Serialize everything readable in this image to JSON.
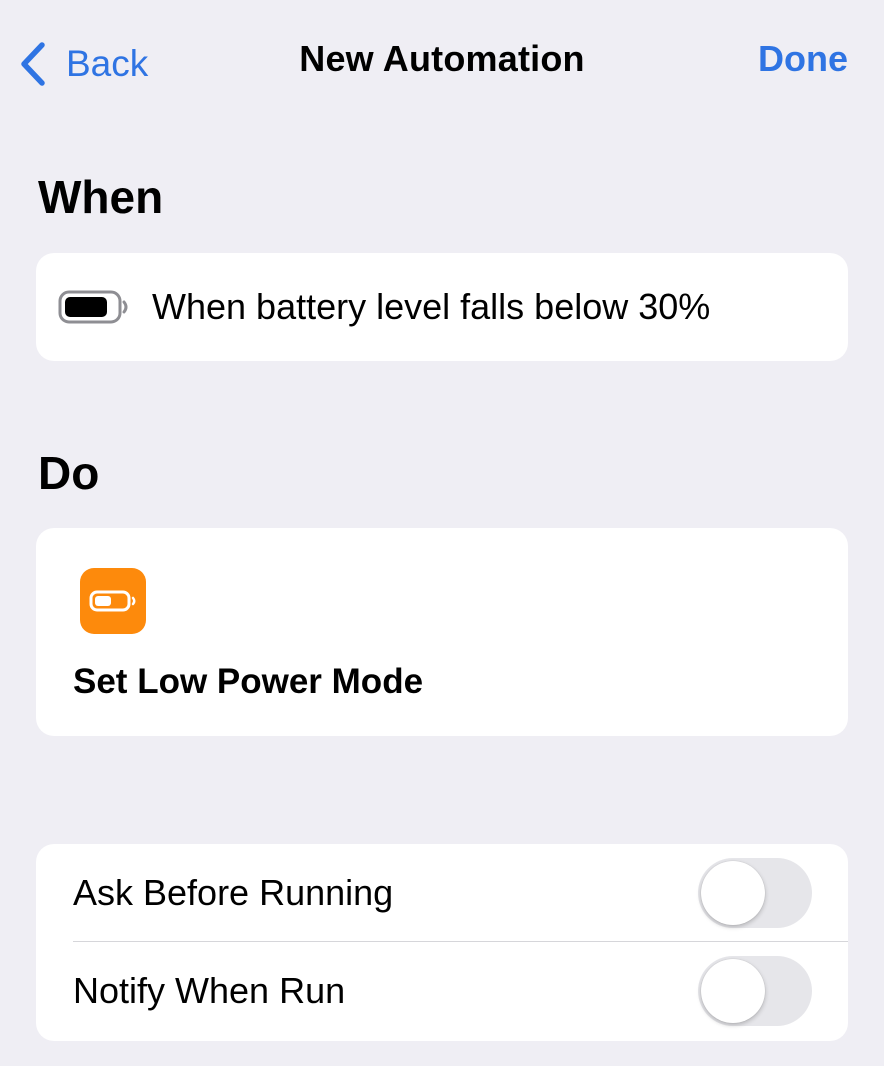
{
  "nav": {
    "back_label": "Back",
    "title": "New Automation",
    "done_label": "Done"
  },
  "when": {
    "heading": "When",
    "trigger_icon": "battery-icon",
    "trigger_text": "When battery level falls below 30%"
  },
  "do": {
    "heading": "Do",
    "action_icon": "low-power-battery-icon",
    "action_icon_color": "#fd8a0c",
    "action_label": "Set Low Power Mode"
  },
  "options": [
    {
      "label": "Ask Before Running",
      "enabled": false
    },
    {
      "label": "Notify When Run",
      "enabled": false
    }
  ],
  "colors": {
    "accent": "#2f74e3",
    "background": "#efeef4",
    "card": "#ffffff",
    "toggle_off": "#e6e6ea"
  }
}
